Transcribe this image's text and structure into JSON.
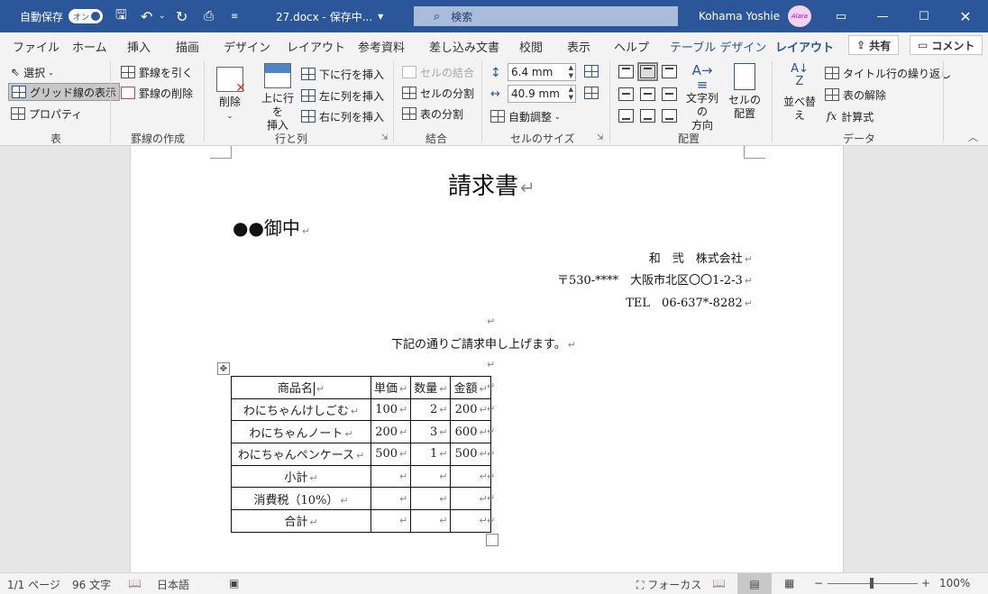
{
  "titlebar": {
    "autosave_label": "自動保存",
    "autosave_state": "オン",
    "doc_title": "27.docx - 保存中...",
    "search_placeholder": "検索",
    "user_name": "Kohama Yoshie",
    "avatar_text": "Alara",
    "accent_color": "#2b579a"
  },
  "tabs": [
    "ファイル",
    "ホーム",
    "挿入",
    "描画",
    "デザイン",
    "レイアウト",
    "参考資料",
    "差し込み文書",
    "校閲",
    "表示",
    "ヘルプ",
    "テーブル デザイン",
    "レイアウト"
  ],
  "share": {
    "share_label": "共有",
    "comment_label": "コメント"
  },
  "ribbon": {
    "table_group": {
      "label": "表",
      "select": "選択",
      "gridlines": "グリッド線の表示",
      "properties": "プロパティ"
    },
    "draw_group": {
      "label": "罫線の作成",
      "draw": "罫線を引く",
      "erase": "罫線の削除"
    },
    "rows_group": {
      "label": "行と列",
      "delete": "削除",
      "insert_above_1": "上に行を",
      "insert_above_2": "挿入",
      "insert_below": "下に行を挿入",
      "insert_left": "左に列を挿入",
      "insert_right": "右に列を挿入"
    },
    "merge_group": {
      "label": "結合",
      "merge": "セルの結合",
      "split_cells": "セルの分割",
      "split_table": "表の分割"
    },
    "size_group": {
      "label": "セルのサイズ",
      "height": "6.4 mm",
      "width": "40.9 mm",
      "autofit": "自動調整"
    },
    "align_group": {
      "label": "配置",
      "direction_1": "文字列の",
      "direction_2": "方向",
      "margins_1": "セルの",
      "margins_2": "配置"
    },
    "data_group": {
      "label": "データ",
      "sort": "並べ替え",
      "repeat_header": "タイトル行の繰り返し",
      "convert": "表の解除",
      "formula": "計算式"
    }
  },
  "document": {
    "title": "請求書",
    "recipient": "●●御中",
    "company": "和　弐　株式会社",
    "address": "〒530-****　大阪市北区〇〇1-2-3",
    "tel": "TEL　06-637*-8282",
    "intro": "下記の通りご請求申し上げます。",
    "table": {
      "headers": [
        "商品名",
        "単価",
        "数量",
        "金額"
      ],
      "rows": [
        [
          "わにちゃんけしごむ",
          "100",
          "2",
          "200"
        ],
        [
          "わにちゃんノート",
          "200",
          "3",
          "600"
        ],
        [
          "わにちゃんペンケース",
          "500",
          "1",
          "500"
        ],
        [
          "小計",
          "",
          "",
          ""
        ],
        [
          "消費税（10%）",
          "",
          "",
          ""
        ],
        [
          "合計",
          "",
          "",
          ""
        ]
      ]
    }
  },
  "statusbar": {
    "page": "1/1 ページ",
    "words": "96 文字",
    "language": "日本語",
    "focus": "フォーカス",
    "zoom": "100%"
  }
}
